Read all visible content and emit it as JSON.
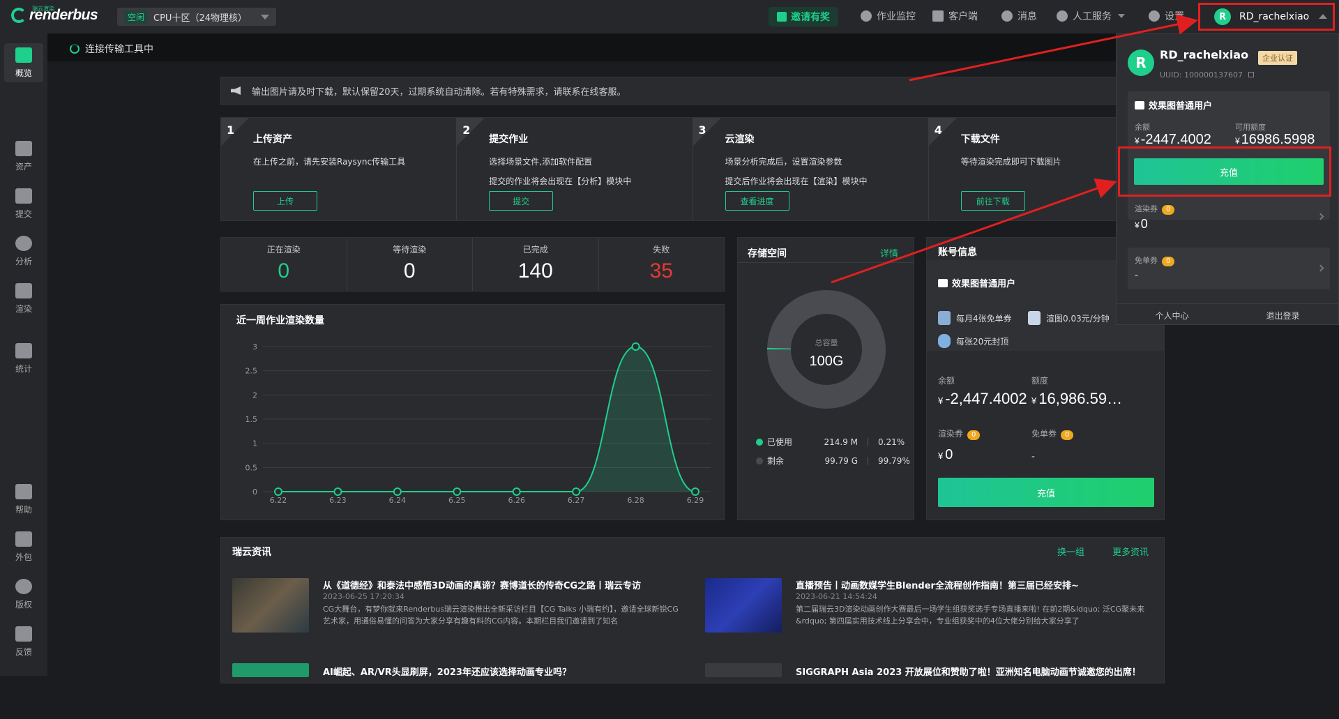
{
  "topbar": {
    "logo_text": "renderbus",
    "logo_sub": "瑞云渲染",
    "region_status": "空闲",
    "region_label": "CPU十区（24物理核）",
    "invite": "邀请有奖",
    "nav": [
      {
        "label": "作业监控",
        "icon": "monitor-icon"
      },
      {
        "label": "客户端",
        "icon": "download-icon"
      },
      {
        "label": "消息",
        "icon": "bell-icon"
      },
      {
        "label": "人工服务",
        "icon": "headset-icon"
      },
      {
        "label": "设置",
        "icon": "gear-icon"
      }
    ],
    "user_initial": "R",
    "username": "RD_rachelxiao"
  },
  "sidebar": {
    "items": [
      {
        "label": "概览",
        "icon": "overview-icon"
      },
      {
        "label": "资产",
        "icon": "folder-icon"
      },
      {
        "label": "提交",
        "icon": "upload-icon"
      },
      {
        "label": "分析",
        "icon": "analysis-icon"
      },
      {
        "label": "渲染",
        "icon": "render-icon"
      },
      {
        "label": "统计",
        "icon": "stats-icon"
      },
      {
        "label": "帮助",
        "icon": "help-icon"
      },
      {
        "label": "外包",
        "icon": "outsource-icon"
      },
      {
        "label": "版权",
        "icon": "copyright-icon"
      },
      {
        "label": "反馈",
        "icon": "feedback-icon"
      }
    ]
  },
  "connection": {
    "label": "连接传输工具中"
  },
  "notice": {
    "text": "输出图片请及时下载，默认保留20天，过期系统自动清除。若有特殊需求，请联系在线客服。"
  },
  "steps": [
    {
      "num": "1",
      "title": "上传资产",
      "lines": [
        "在上传之前，请先安装Raysync传输工具"
      ],
      "button": "上传"
    },
    {
      "num": "2",
      "title": "提交作业",
      "lines": [
        "选择场景文件,添加软件配置",
        "提交的作业将会出现在【分析】模块中"
      ],
      "button": "提交"
    },
    {
      "num": "3",
      "title": "云渲染",
      "lines": [
        "场景分析完成后，设置渲染参数",
        "提交后作业将会出现在【渲染】模块中"
      ],
      "button": "查看进度"
    },
    {
      "num": "4",
      "title": "下载文件",
      "lines": [
        "等待渲染完成即可下载图片"
      ],
      "button": "前往下载"
    }
  ],
  "counts": [
    {
      "label": "正在渲染",
      "value": "0",
      "color": "#1fcf8c"
    },
    {
      "label": "等待渲染",
      "value": "0",
      "color": "#ffffff"
    },
    {
      "label": "已完成",
      "value": "140",
      "color": "#ffffff"
    },
    {
      "label": "失败",
      "value": "35",
      "color": "#e53935"
    }
  ],
  "chart_data": {
    "type": "area",
    "title": "近一周作业渲染数量",
    "categories": [
      "6.22",
      "6.23",
      "6.24",
      "6.25",
      "6.26",
      "6.27",
      "6.28",
      "6.29"
    ],
    "values": [
      0,
      0,
      0,
      0,
      0,
      0,
      3,
      0
    ],
    "yticks": [
      "0",
      "0.5",
      "1",
      "1.5",
      "2",
      "2.5",
      "3"
    ],
    "ylim": [
      0,
      3
    ],
    "grid": true,
    "color": "#1fcf8c"
  },
  "storage": {
    "title": "存储空间",
    "detail": "详情",
    "total_label": "总容量",
    "total_value": "100G",
    "used_fraction": 0.0021,
    "rows": [
      {
        "label": "已使用",
        "size": "214.9 M",
        "pct": "0.21%",
        "color": "#1fcf8c"
      },
      {
        "label": "剩余",
        "size": "99.79 G",
        "pct": "99.79%",
        "color": "#4a4b50"
      }
    ]
  },
  "account": {
    "title": "账号信息",
    "tier": "效果图普通用户",
    "features": [
      "每月4张免单券",
      "渲图0.03元/分钟",
      "每张20元封顶"
    ],
    "balance_label": "余额",
    "balance": "-2,447.4002",
    "credit_label": "额度",
    "credit": "16,986.59…",
    "coupon_label": "渲染券",
    "coupon_count": "0",
    "coupon_value": "0",
    "free_label": "免单券",
    "free_count": "0",
    "free_value": "-",
    "recharge": "充值",
    "currency": "¥"
  },
  "news": {
    "title": "瑞云资讯",
    "refresh": "换一组",
    "more": "更多资讯",
    "items": [
      {
        "title": "从《道德经》和泰法中感悟3D动画的真谛？赛博道长的传奇CG之路丨瑞云专访",
        "date": "2023-06-25 17:20:34",
        "excerpt": "CG大舞台，有梦你就来Renderbus瑞云渲染推出全新采访栏目【CG Talks 小瑞有约】，邀请全球新锐CG艺术家，用通俗易懂的问答为大家分享有趣有料的CG内容。本期栏目我们邀请到了知名"
      },
      {
        "title": "直播预告丨动画数媒学生Blender全流程创作指南！第三届已经安排~",
        "date": "2023-06-21 14:54:24",
        "excerpt": "第二届瑞云3D渲染动画创作大赛最后一场学生组获奖选手专场直播来啦! 在前2期&ldquo; 泛CG聚未来 &rdquo; 第四届实用技术线上分享会中，专业组获奖中的4位大佬分别给大家分享了"
      },
      {
        "title": "AI崛起、AR/VR头显刷屏，2023年还应该选择动画专业吗？",
        "date": "",
        "excerpt": ""
      },
      {
        "title": "SIGGRAPH Asia 2023 开放展位和赞助了啦！亚洲知名电脑动画节诚邀您的出席！",
        "date": "",
        "excerpt": ""
      }
    ]
  },
  "dropdown": {
    "initial": "R",
    "username": "RD_rachelxiao",
    "enterprise": "企业认证",
    "uuid": "UUID: 100000137607",
    "tier": "效果图普通用户",
    "balance_label": "余额",
    "balance": "-2447.4002",
    "credit_label": "可用额度",
    "credit": "16986.5998",
    "currency": "¥",
    "recharge": "充值",
    "coupon_label": "渲染券",
    "coupon_count": "0",
    "coupon_value": "0",
    "free_label": "免单券",
    "free_count": "0",
    "free_value": "-",
    "personal_center": "个人中心",
    "logout": "退出登录"
  }
}
